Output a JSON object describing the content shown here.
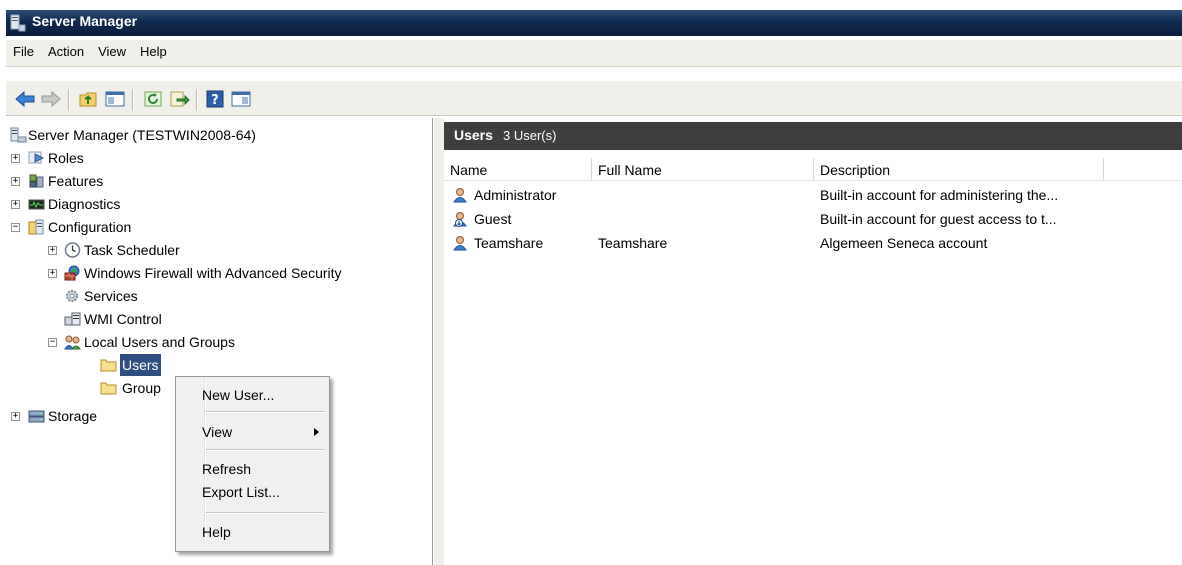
{
  "window": {
    "title": "Server Manager"
  },
  "menubar": {
    "items": [
      "File",
      "Action",
      "View",
      "Help"
    ]
  },
  "toolbar": {
    "buttons": [
      "back-arrow-icon",
      "forward-arrow-icon",
      "up-folder-icon",
      "show-hide-console-tree-icon",
      "refresh-icon",
      "export-list-icon",
      "help-icon",
      "show-hide-action-pane-icon"
    ]
  },
  "tree": {
    "root": "Server Manager (TESTWIN2008-64)",
    "items": [
      {
        "label": "Roles",
        "expander": "+"
      },
      {
        "label": "Features",
        "expander": "+"
      },
      {
        "label": "Diagnostics",
        "expander": "+"
      },
      {
        "label": "Configuration",
        "expander": "−"
      },
      {
        "label": "Task Scheduler",
        "expander": "+"
      },
      {
        "label": "Windows Firewall with Advanced Security",
        "expander": "+"
      },
      {
        "label": "Services"
      },
      {
        "label": "WMI Control"
      },
      {
        "label": "Local Users and Groups",
        "expander": "−"
      },
      {
        "label": "Users",
        "selected": true
      },
      {
        "label": "Group"
      },
      {
        "label": "Storage",
        "expander": "+"
      }
    ]
  },
  "panel": {
    "title": "Users",
    "count": "3 User(s)",
    "columns": [
      "Name",
      "Full Name",
      "Description"
    ],
    "rows": [
      {
        "name": "Administrator",
        "full_name": "",
        "description": "Built-in account for administering the..."
      },
      {
        "name": "Guest",
        "full_name": "",
        "description": "Built-in account for guest access to t..."
      },
      {
        "name": "Teamshare",
        "full_name": "Teamshare",
        "description": "Algemeen Seneca account"
      }
    ]
  },
  "context_menu": {
    "items": [
      "New User...",
      "View",
      "Refresh",
      "Export List...",
      "Help"
    ]
  },
  "colors": {
    "titlebar": "#10294e",
    "selection": "#2f4f82",
    "panel_header": "#3f3f3f",
    "chrome": "#f0efea"
  }
}
